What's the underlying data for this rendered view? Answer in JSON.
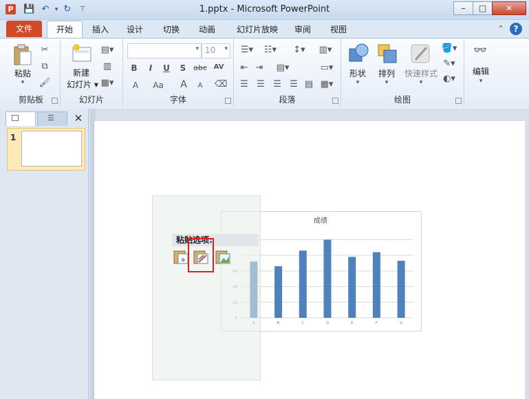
{
  "window": {
    "title": "1.pptx  -  Microsoft PowerPoint",
    "app_icon": "P",
    "controls": [
      "–",
      "□",
      "✕"
    ]
  },
  "tabs": [
    {
      "id": "file",
      "label": "文件"
    },
    {
      "id": "home",
      "label": "开始"
    },
    {
      "id": "insert",
      "label": "插入"
    },
    {
      "id": "design",
      "label": "设计"
    },
    {
      "id": "transitions",
      "label": "切换"
    },
    {
      "id": "animations",
      "label": "动画"
    },
    {
      "id": "slideshow",
      "label": "幻灯片放映"
    },
    {
      "id": "review",
      "label": "审阅"
    },
    {
      "id": "view",
      "label": "视图"
    }
  ],
  "ribbon": {
    "clipboard": {
      "group": "剪贴板",
      "paste": "粘贴"
    },
    "slides": {
      "group": "幻灯片",
      "new_slide_1": "新建",
      "new_slide_2": "幻灯片"
    },
    "font": {
      "group": "字体",
      "font_name": "",
      "font_size": "10",
      "bold": "B",
      "italic": "I",
      "underline": "U",
      "shadow": "S",
      "strike": "abc",
      "spacing": "AV",
      "color": "A",
      "case": "Aa",
      "grow": "A",
      "shrink": "A"
    },
    "paragraph": {
      "group": "段落"
    },
    "drawing": {
      "group": "绘图",
      "shapes": "形状",
      "arrange": "排列",
      "quick_styles": "快速样式"
    },
    "editing": {
      "edit": "编辑"
    }
  },
  "slides_pane": {
    "slide_number": "1"
  },
  "paste_options": {
    "title": "粘贴选项:"
  },
  "chart_data": {
    "type": "bar",
    "title": "成绩",
    "categories": [
      "A",
      "B",
      "C",
      "D",
      "E",
      "F",
      "G"
    ],
    "values": [
      72,
      66,
      86,
      100,
      78,
      84,
      73
    ],
    "yticks": [
      0,
      20,
      40,
      60
    ],
    "ylim": [
      0,
      110
    ],
    "color": "#4f81bd",
    "grid": true
  },
  "colors": {
    "accent": "#d14a25",
    "bar": "#4f81bd",
    "highlight": "#e02020"
  }
}
